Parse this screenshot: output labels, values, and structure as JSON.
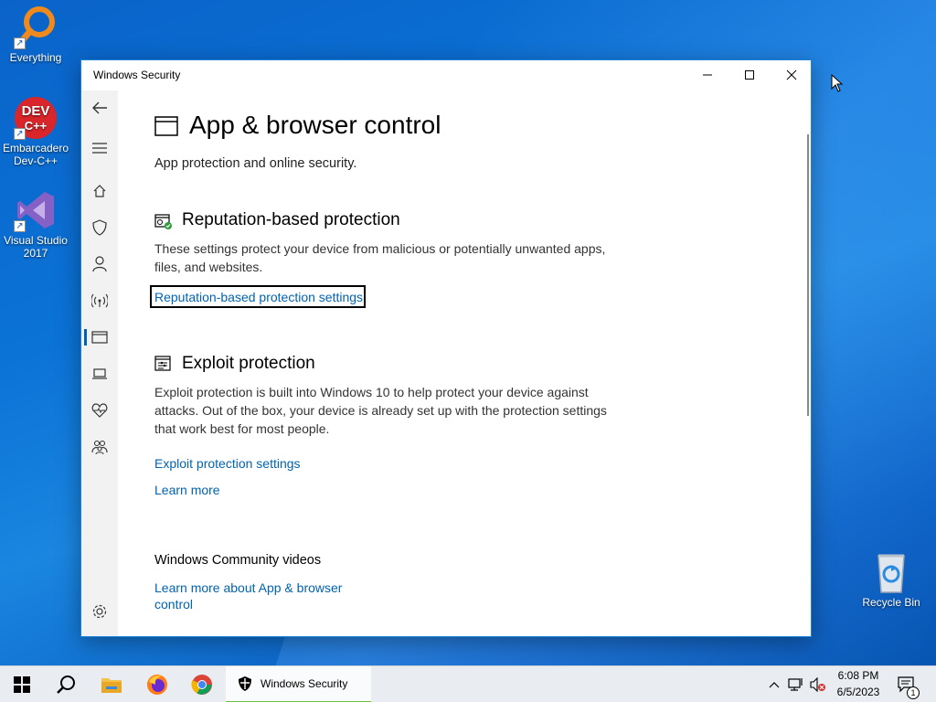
{
  "desktop": {
    "icons": [
      {
        "label": "Everything"
      },
      {
        "label": "Embarcadero Dev-C++"
      },
      {
        "label": "Visual Studio 2017"
      },
      {
        "label": "Recycle Bin"
      }
    ],
    "devcpp_badge": "DEV C++"
  },
  "window": {
    "title": "Windows Security",
    "page_title": "App & browser control",
    "subtitle": "App protection and online security.",
    "sections": [
      {
        "title": "Reputation-based protection",
        "description": "These settings protect your device from malicious or potentially unwanted apps, files, and websites.",
        "link": "Reputation-based protection settings"
      },
      {
        "title": "Exploit protection",
        "description": "Exploit protection is built into Windows 10 to help protect your device against attacks.  Out of the box, your device is already set up with the protection settings that work best for most people.",
        "link": "Exploit protection settings",
        "link2": "Learn more"
      }
    ],
    "community": {
      "heading": "Windows Community videos",
      "link": "Learn more about App & browser control"
    },
    "accent": "#0063b1"
  },
  "taskbar": {
    "active_app_label": "Windows Security",
    "time": "6:08 PM",
    "date": "6/5/2023",
    "notification_count": "1"
  }
}
